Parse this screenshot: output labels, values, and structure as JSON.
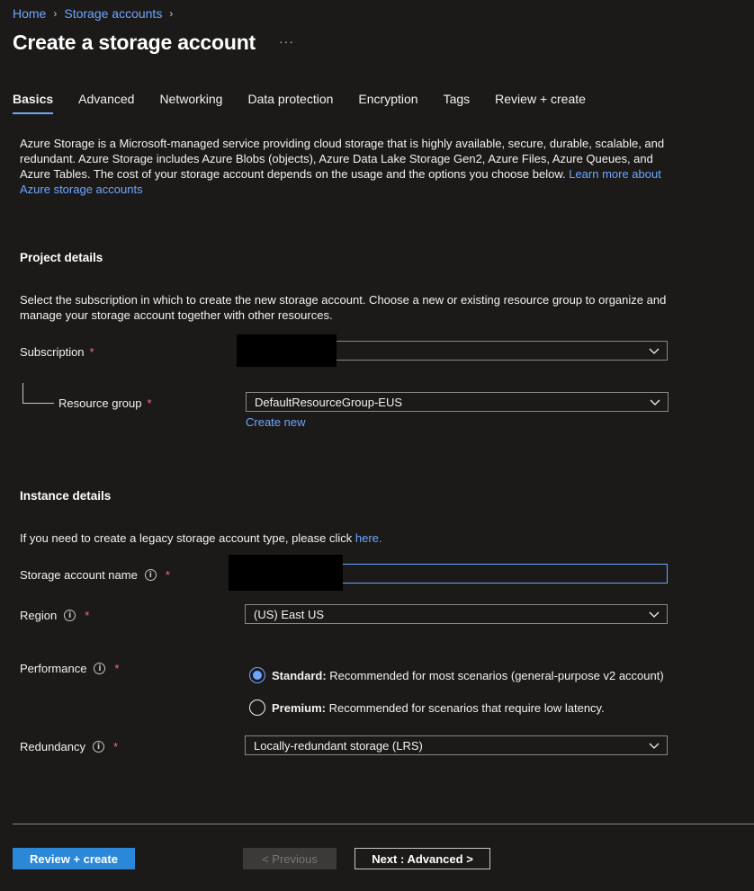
{
  "breadcrumb": {
    "home": "Home",
    "storage_accounts": "Storage accounts"
  },
  "page_title": "Create a storage account",
  "more_label": "···",
  "tabs": [
    {
      "label": "Basics"
    },
    {
      "label": "Advanced"
    },
    {
      "label": "Networking"
    },
    {
      "label": "Data protection"
    },
    {
      "label": "Encryption"
    },
    {
      "label": "Tags"
    },
    {
      "label": "Review + create"
    }
  ],
  "intro": {
    "text": "Azure Storage is a Microsoft-managed service providing cloud storage that is highly available, secure, durable, scalable, and redundant. Azure Storage includes Azure Blobs (objects), Azure Data Lake Storage Gen2, Azure Files, Azure Queues, and Azure Tables. The cost of your storage account depends on the usage and the options you choose below. ",
    "link": "Learn more about Azure storage accounts"
  },
  "project": {
    "heading": "Project details",
    "description": "Select the subscription in which to create the new storage account. Choose a new or existing resource group to organize and manage your storage account together with other resources.",
    "subscription_label": "Subscription",
    "resource_group_label": "Resource group",
    "resource_group_value": "DefaultResourceGroup-EUS",
    "create_new": "Create new"
  },
  "instance": {
    "heading": "Instance details",
    "legacy_text": "If you need to create a legacy storage account type, please click ",
    "legacy_link": "here.",
    "name_label": "Storage account name",
    "region_label": "Region",
    "region_value": "(US) East US",
    "performance_label": "Performance",
    "standard_title": "Standard:",
    "standard_desc": " Recommended for most scenarios (general-purpose v2 account)",
    "premium_title": "Premium:",
    "premium_desc": " Recommended for scenarios that require low latency.",
    "performance_selected": "standard",
    "redundancy_label": "Redundancy",
    "redundancy_value": "Locally-redundant storage (LRS)"
  },
  "required_mark": "*",
  "info_glyph": "i",
  "footer": {
    "review_create": "Review + create",
    "previous": "< Previous",
    "next": "Next : Advanced >"
  },
  "colors": {
    "background": "#1b1a19",
    "accent": "#6ea6ff",
    "primary_button": "#2b88d8",
    "required": "#f1707b"
  }
}
